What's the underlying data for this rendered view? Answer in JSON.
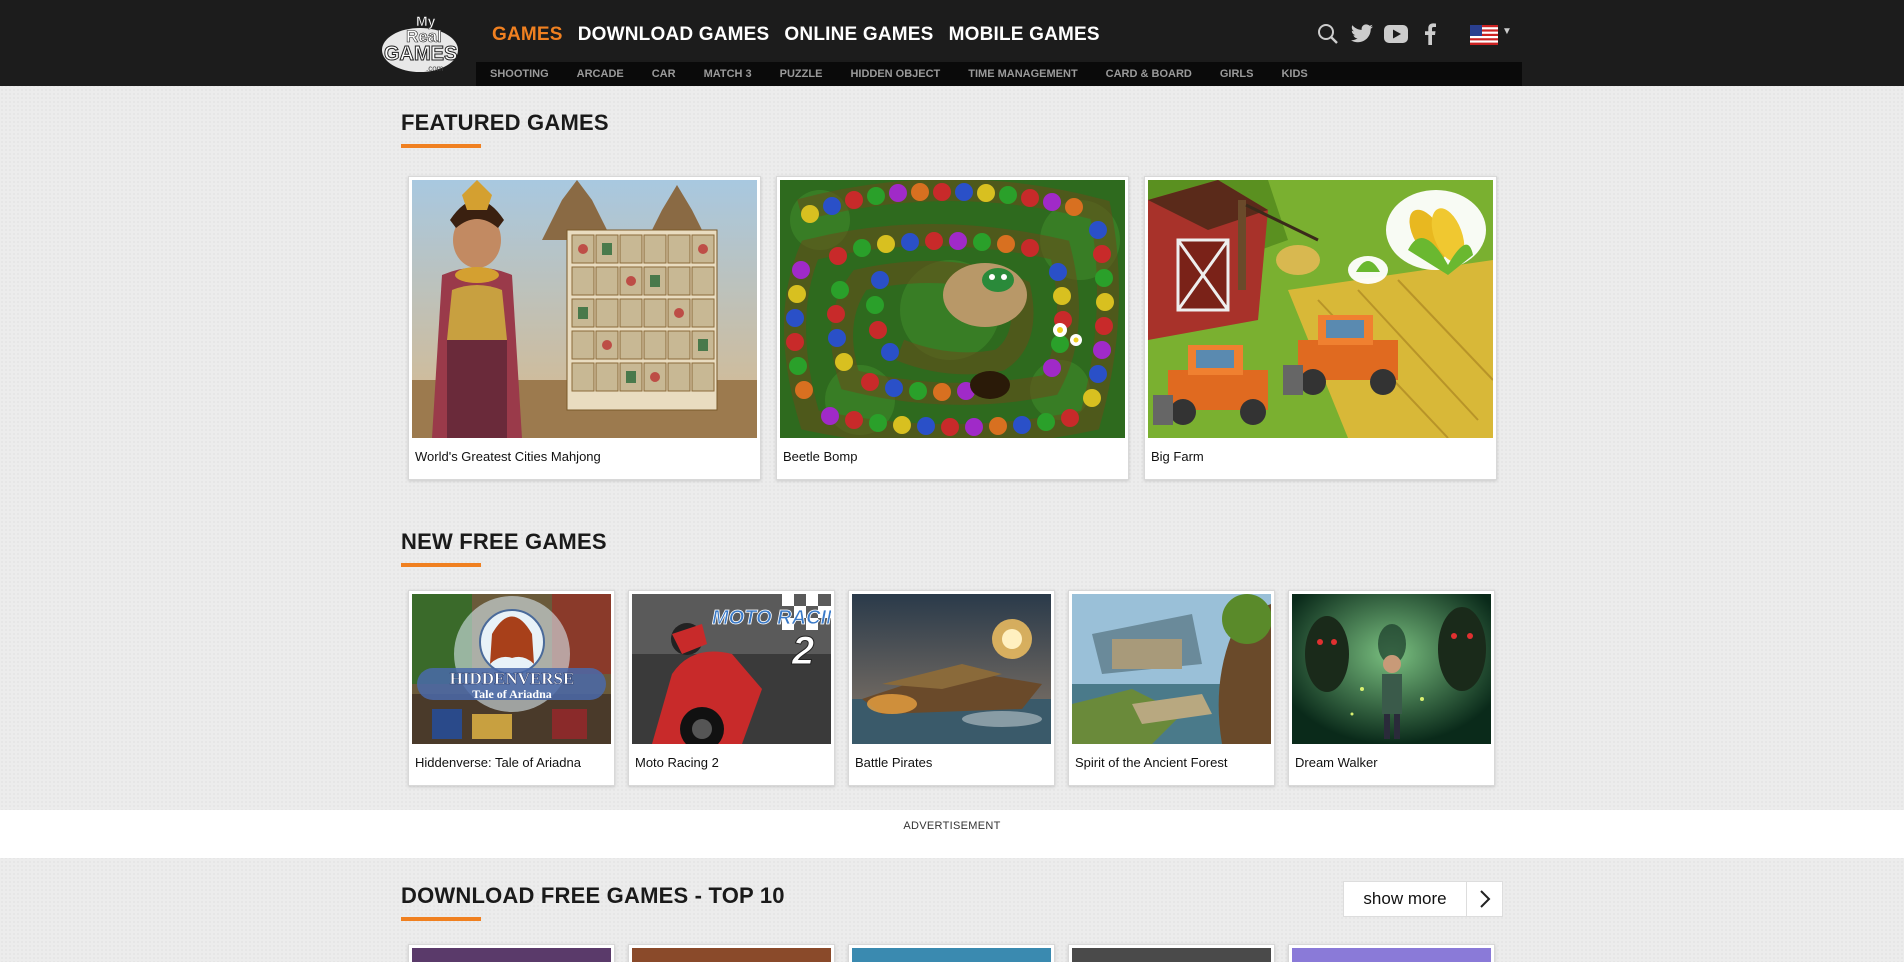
{
  "header": {
    "logo_text": [
      "My",
      "Real",
      "GAMES",
      ".com"
    ],
    "main_nav": [
      {
        "label": "GAMES",
        "active": true
      },
      {
        "label": "DOWNLOAD GAMES",
        "active": false
      },
      {
        "label": "ONLINE GAMES",
        "active": false
      },
      {
        "label": "MOBILE GAMES",
        "active": false
      }
    ],
    "sub_nav": [
      "SHOOTING",
      "ARCADE",
      "CAR",
      "MATCH 3",
      "PUZZLE",
      "HIDDEN OBJECT",
      "TIME MANAGEMENT",
      "CARD & BOARD",
      "GIRLS",
      "KIDS"
    ],
    "icons": [
      "search-icon",
      "twitter-icon",
      "youtube-icon",
      "facebook-icon"
    ],
    "language_flag": "us-flag-icon"
  },
  "featured": {
    "title": "FEATURED GAMES",
    "games": [
      {
        "name": "World's Greatest Cities Mahjong"
      },
      {
        "name": "Beetle Bomp"
      },
      {
        "name": "Big Farm"
      }
    ]
  },
  "new_free": {
    "title": "NEW FREE GAMES",
    "games": [
      {
        "name": "Hiddenverse: Tale of Ariadna"
      },
      {
        "name": "Moto Racing 2"
      },
      {
        "name": "Battle Pirates"
      },
      {
        "name": "Spirit of the Ancient Forest"
      },
      {
        "name": "Dream Walker"
      }
    ]
  },
  "thumb_text": {
    "hiddenverse_title": "HIDDENVERSE",
    "hiddenverse_sub": "Tale of Ariadna",
    "moto_title": "MOTO RACING",
    "moto_num": "2"
  },
  "advertisement": {
    "label": "ADVERTISEMENT"
  },
  "top10": {
    "title": "DOWNLOAD FREE GAMES - TOP 10",
    "show_more": "show more"
  },
  "colors": {
    "accent": "#f08020",
    "header_bg": "#1c1c1c",
    "subnav_bg": "#0a0a0a"
  }
}
